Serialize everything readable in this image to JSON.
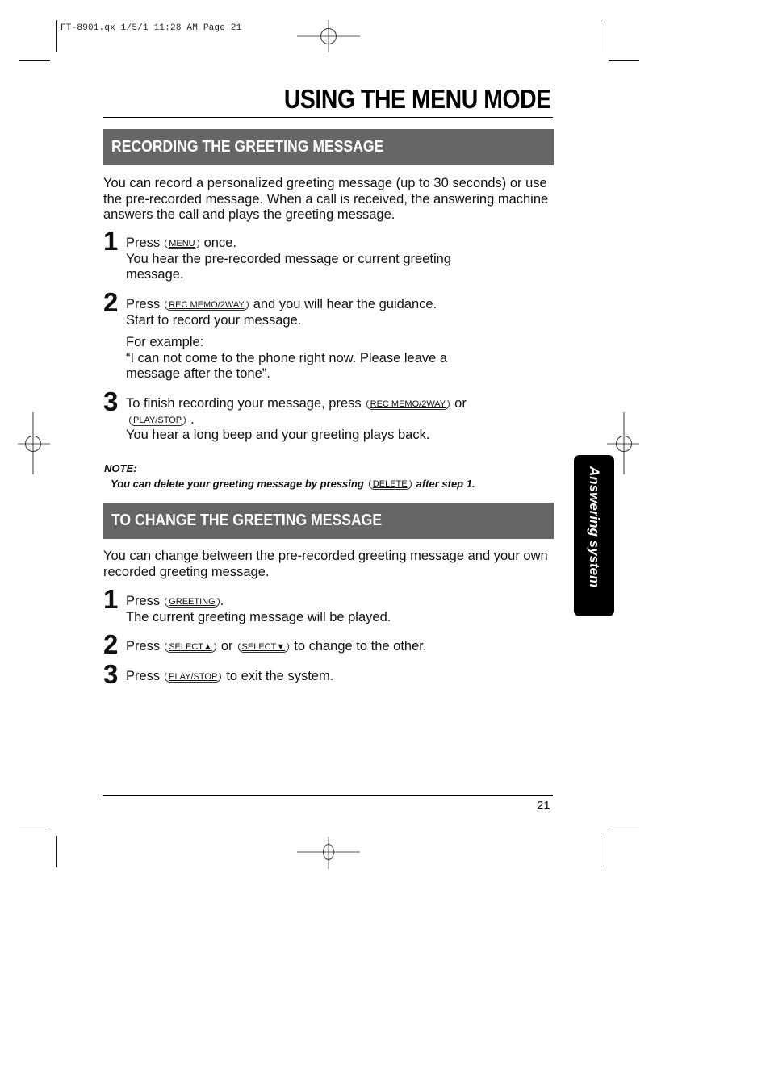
{
  "slug": "FT-8901.qx  1/5/1 11:28 AM  Page 21",
  "title": "USING THE MENU MODE",
  "side_tab": "Answering system",
  "page_number": "21",
  "sections": [
    {
      "heading": "RECORDING THE GREETING MESSAGE",
      "intro": "You can record a personalized greeting message (up to 30 seconds) or use the pre-recorded message. When a call is received, the answering machine answers the call and plays the greeting message.",
      "steps": [
        {
          "number": "1",
          "pre": "Press",
          "key": "MENU",
          "post": "once.",
          "line2": "You hear the pre-recorded message or current greeting message."
        },
        {
          "number": "2",
          "pre": "Press",
          "key": "REC MEMO/2WAY",
          "post": "and you will hear the guidance.",
          "line2": "Start to record your message.",
          "example_label": "For example:",
          "example_text": "“I can not come to the phone right now. Please leave a message after the tone”."
        },
        {
          "number": "3",
          "pre": "To finish recording your message, press",
          "key": "REC MEMO/2WAY",
          "mid": "or",
          "key2": "PLAY/STOP",
          "post": ".",
          "line2": "You hear a long beep and your greeting plays back."
        }
      ],
      "note": {
        "label": "NOTE:",
        "pre": "You can delete your greeting message by pressing",
        "key": "DELETE",
        "post": "after step 1."
      }
    },
    {
      "heading": "TO CHANGE THE GREETING MESSAGE",
      "intro": "You can change between the pre-recorded greeting message and your own recorded greeting message.",
      "steps": [
        {
          "number": "1",
          "pre": "Press",
          "key": "GREETING",
          "post": ".",
          "line2": "The current greeting message will be played."
        },
        {
          "number": "2",
          "pre": "Press",
          "key": "SELECT▲",
          "mid": "or",
          "key2": "SELECT▼",
          "post": "to change to the other."
        },
        {
          "number": "3",
          "pre": "Press",
          "key": "PLAY/STOP",
          "post": "to exit the system."
        }
      ]
    }
  ]
}
